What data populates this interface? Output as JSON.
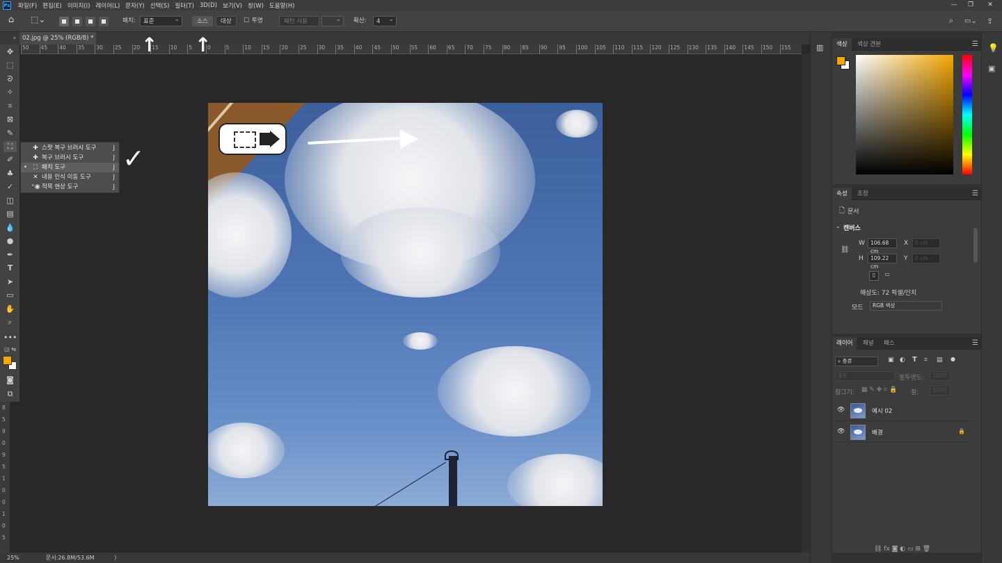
{
  "menubar": {
    "items": [
      "파일(F)",
      "편집(E)",
      "이미지(I)",
      "레이어(L)",
      "문자(Y)",
      "선택(S)",
      "필터(T)",
      "3D(D)",
      "보기(V)",
      "창(W)",
      "도움말(H)"
    ],
    "logo": "Ps"
  },
  "options": {
    "patch_label": "패치:",
    "patch_value": "표준",
    "source_btn": "소스",
    "target_btn": "대상",
    "transparent_label": "투명",
    "use_pattern_btn": "패턴 사용",
    "diffusion_label": "확산:",
    "diffusion_value": "4"
  },
  "document": {
    "tab_title": "02.jpg @ 25% (RGB/8) *",
    "close": "×"
  },
  "ruler": {
    "labels": [
      "50",
      "45",
      "40",
      "35",
      "30",
      "25",
      "20",
      "15",
      "10",
      "5",
      "0",
      "5",
      "10",
      "15",
      "20",
      "25",
      "30",
      "35",
      "40",
      "45",
      "50",
      "55",
      "60",
      "65",
      "70",
      "75",
      "80",
      "85",
      "90",
      "95",
      "100",
      "105",
      "110",
      "115",
      "120",
      "125",
      "130",
      "135",
      "140",
      "145",
      "150",
      "155"
    ],
    "v_labels": [
      "8",
      "5",
      "9",
      "0",
      "9",
      "5",
      "1",
      "0",
      "0",
      "1",
      "0",
      "5"
    ]
  },
  "status": {
    "zoom": "25%",
    "doc": "문서:26.8M/53.6M",
    "arrow": "〉"
  },
  "submenu": {
    "items": [
      {
        "icon": "spot-healing-brush-icon",
        "label": "스팟 복구 브러시 도구",
        "key": "J",
        "active": false
      },
      {
        "icon": "healing-brush-icon",
        "label": "복구 브러시 도구",
        "key": "J",
        "active": false
      },
      {
        "icon": "patch-icon",
        "label": "패치 도구",
        "key": "J",
        "active": true
      },
      {
        "icon": "content-aware-move-icon",
        "label": "내용 인식 이동 도구",
        "key": "J",
        "active": false
      },
      {
        "icon": "red-eye-icon",
        "label": "적목 현상 도구",
        "key": "J",
        "active": false
      }
    ],
    "bullet": "•"
  },
  "color_panel": {
    "tabs": [
      "색상",
      "색상 견본"
    ],
    "foreground": "#f5a700",
    "background": "#ffffff"
  },
  "properties": {
    "tabs": [
      "속성",
      "조정"
    ],
    "doc_label": "문서",
    "canvas_label": "캔버스",
    "w_label": "W",
    "w_value": "106.68 cm",
    "h_label": "H",
    "h_value": "109.22 cm",
    "x_label": "X",
    "x_value": "0 cm",
    "y_label": "Y",
    "y_value": "0 cm",
    "resolution": "해상도: 72 픽셀/인치",
    "mode_label": "모드",
    "mode_value": "RGB 색상"
  },
  "layers": {
    "tabs": [
      "레이어",
      "채널",
      "패스"
    ],
    "filter_value": "종류",
    "blend_value": "표준",
    "opacity_label": "불투명도:",
    "opacity_value": "100%",
    "lock_label": "잠그기:",
    "fill_label": "칠:",
    "fill_value": "100%",
    "items": [
      {
        "name": "예시 02",
        "locked": false
      },
      {
        "name": "배경",
        "locked": true
      }
    ]
  },
  "colors": {
    "accent": "#f5a700",
    "chrome": "#424242",
    "canvas_bg": "#282828"
  }
}
